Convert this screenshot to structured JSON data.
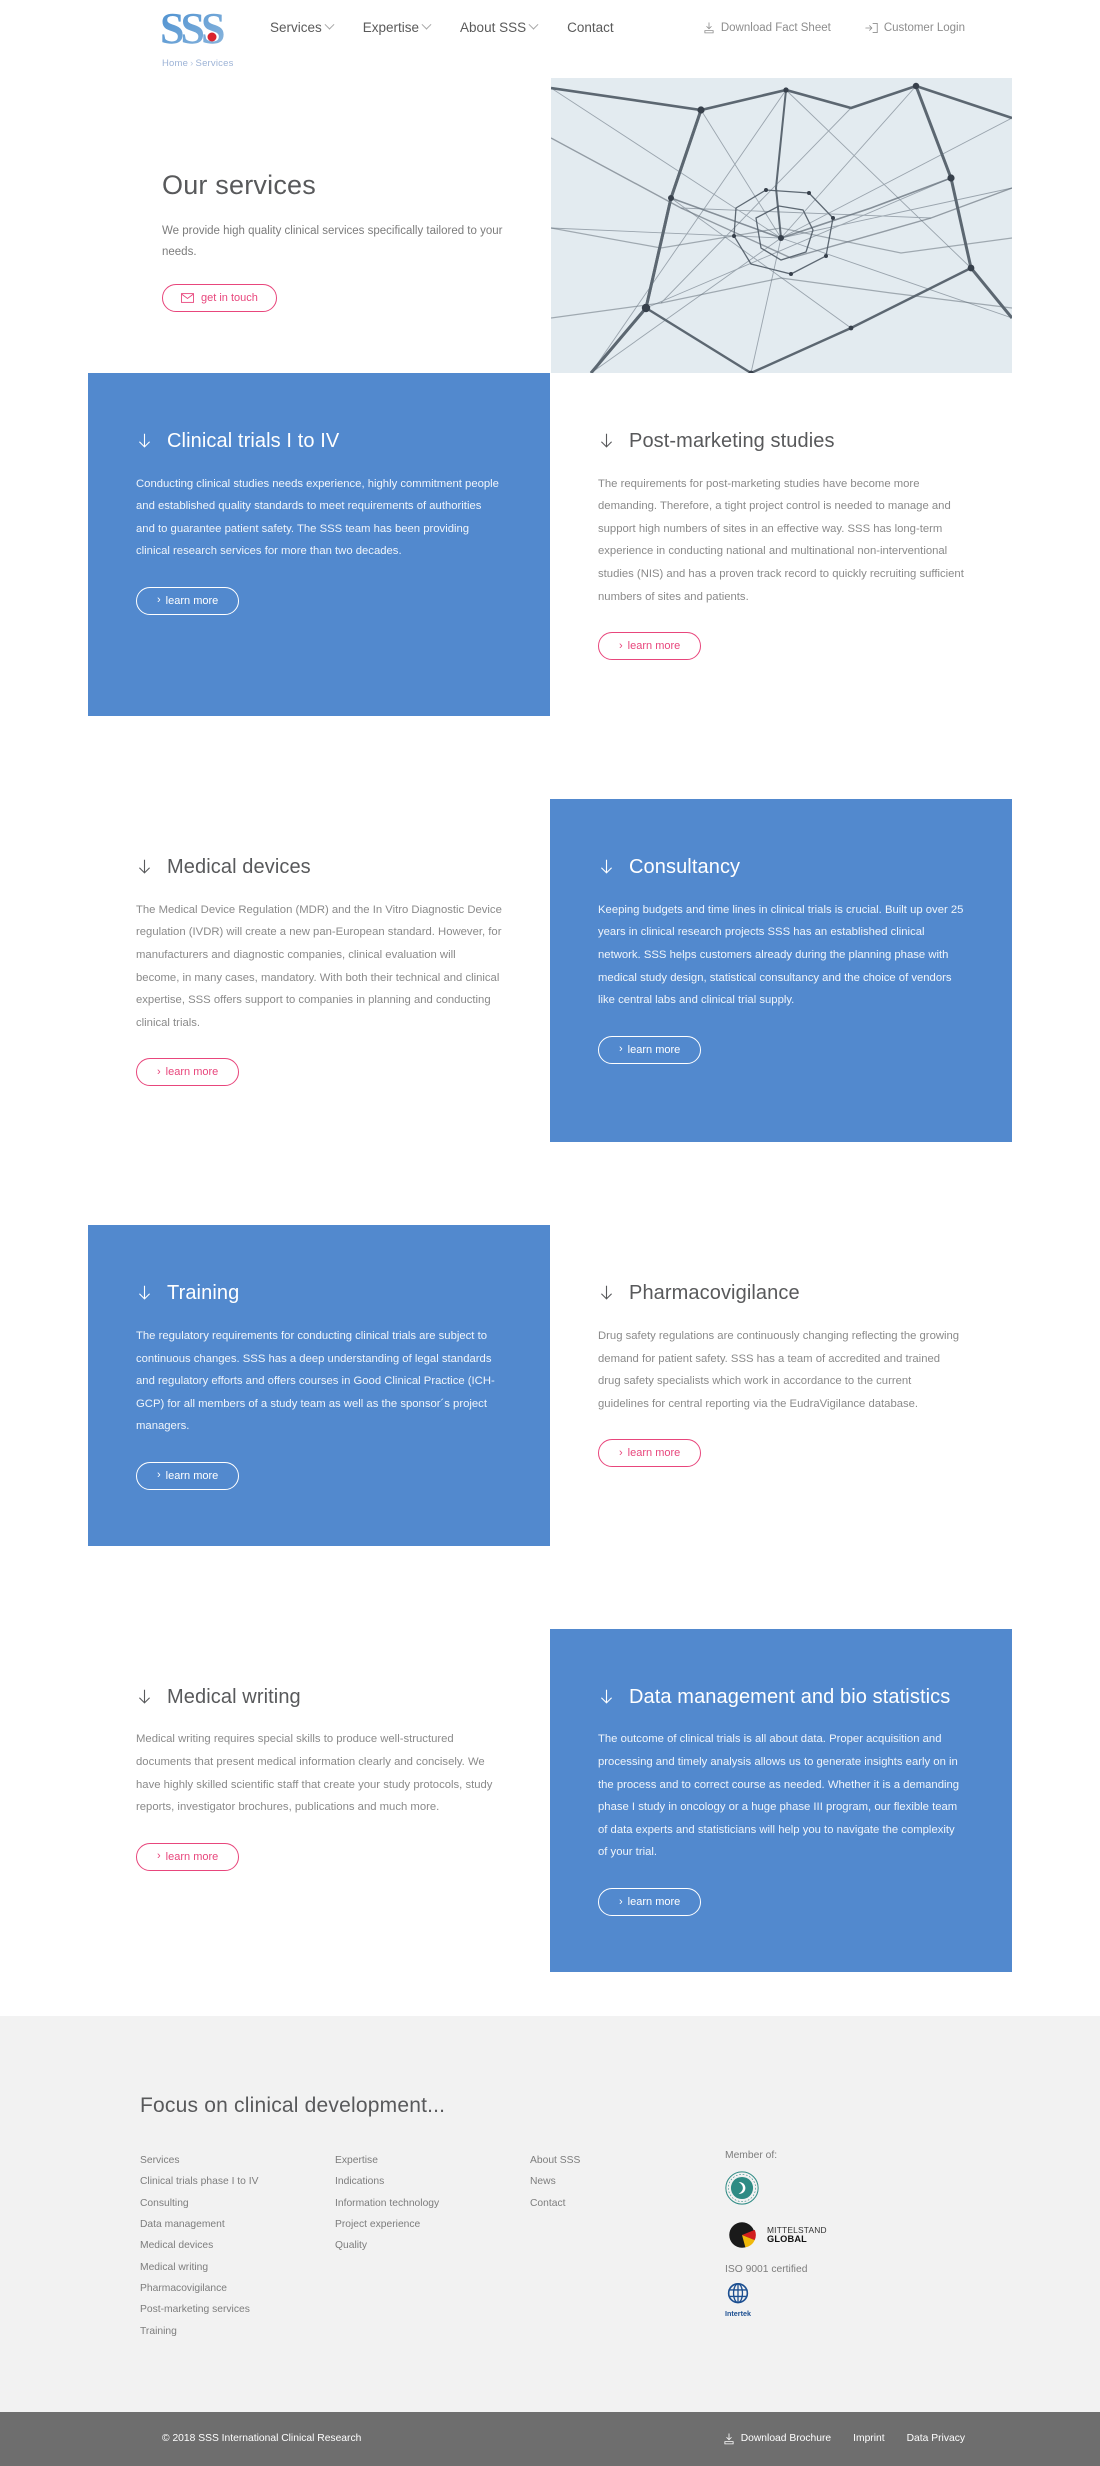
{
  "header": {
    "logo_alt": "SSS",
    "breadcrumb": {
      "home": "Home",
      "separator": "›",
      "current": "Services"
    },
    "nav": [
      {
        "label": "Services",
        "has_caret": true
      },
      {
        "label": "Expertise",
        "has_caret": true
      },
      {
        "label": "About SSS",
        "has_caret": true
      },
      {
        "label": "Contact",
        "has_caret": false
      }
    ],
    "util": [
      {
        "label": "Download Fact Sheet",
        "icon": "download-icon"
      },
      {
        "label": "Customer Login",
        "icon": "login-icon"
      }
    ]
  },
  "hero": {
    "title": "Our services",
    "subtitle": "We provide high quality clinical services specifically tailored to your needs.",
    "cta_label": "get in touch",
    "cta_icon": "envelope-icon"
  },
  "cards": [
    {
      "title": "Clinical trials I to IV",
      "body": "Conducting clinical studies needs experience, highly commitment people and established quality standards to meet requirements of authorities and to guarantee patient safety. The SSS team has been providing clinical research services for more than two decades.",
      "cta": "learn more",
      "theme": "blue"
    },
    {
      "title": "Post-marketing studies",
      "body": "The requirements for post-marketing studies have become more demanding. Therefore, a tight project control is needed to manage and support high numbers of sites in an effective way. SSS has long-term experience in conducting national and multinational non-interventional studies (NIS) and has a proven track record to quickly recruiting sufficient numbers of sites and patients.",
      "cta": "learn more",
      "theme": "white"
    },
    {
      "title": "Medical devices",
      "body": "The Medical Device Regulation (MDR) and the In Vitro Diagnostic Device regulation (IVDR) will create a new pan-European standard. However, for manufacturers and diagnostic companies, clinical evaluation will become, in many cases, mandatory. With both their technical and clinical expertise, SSS offers support to companies in planning and conducting clinical trials.",
      "cta": "learn more",
      "theme": "white"
    },
    {
      "title": "Consultancy",
      "body": "Keeping budgets and time lines in clinical trials is crucial. Built up over 25 years in clinical research projects SSS has an established clinical network. SSS helps customers already during the planning phase with medical study design, statistical consultancy and the choice of vendors like central labs and clinical trial supply.",
      "cta": "learn more",
      "theme": "blue"
    },
    {
      "title": "Training",
      "body": "The regulatory requirements for conducting clinical trials are subject to continuous changes. SSS has a deep understanding of legal standards and regulatory efforts and offers courses in Good Clinical Practice (ICH-GCP) for all members of a study team as well as the sponsor´s project managers.",
      "cta": "learn more",
      "theme": "blue"
    },
    {
      "title": "Pharmacovigilance",
      "body": "Drug safety regulations are continuously changing reflecting the growing demand for patient safety. SSS has a team of accredited and trained drug safety specialists which work in accordance to the current guidelines for central reporting via the EudraVigilance database.",
      "cta": "learn more",
      "theme": "white"
    },
    {
      "title": "Medical writing",
      "body": "Medical writing requires special skills to produce well-structured documents that present medical information clearly and concisely. We have highly skilled scientific staff that create your study protocols, study reports, investigator brochures, publications and much more.",
      "cta": "learn more",
      "theme": "white"
    },
    {
      "title": "Data management and bio statistics",
      "body": "The outcome of clinical trials is all about data. Proper acquisition and processing and timely analysis allows us to generate insights early on in the process and to correct course as needed. Whether it is a demanding phase I study in oncology or a huge phase III program, our flexible team of data experts and statisticians will help you to navigate the complexity of your trial.",
      "cta": "learn more",
      "theme": "blue"
    }
  ],
  "footer": {
    "title": "Focus on clinical development...",
    "columns": [
      [
        "Services",
        "Clinical trials phase I to IV",
        "Consulting",
        "Data management",
        "Medical devices",
        "Medical writing",
        "Pharmacovigilance",
        "Post-marketing services",
        "Training"
      ],
      [
        "Expertise",
        "Indications",
        "Information technology",
        "Project experience",
        "Quality"
      ],
      [
        "About SSS",
        "News",
        "Contact"
      ]
    ],
    "member_label": "Member of:",
    "iso_text": "ISO 9001 certified",
    "mittelstand_line1": "MITTELSTAND",
    "mittelstand_line2": "GLOBAL",
    "intertek_label": "Intertek"
  },
  "bottombar": {
    "copyright": "© 2018 SSS International Clinical Research",
    "links": [
      {
        "label": "Download Brochure",
        "icon": "download-icon"
      },
      {
        "label": "Imprint",
        "icon": null
      },
      {
        "label": "Data Privacy",
        "icon": null
      }
    ]
  },
  "colors": {
    "brand_blue": "#5289ce",
    "accent_pink": "#e8467c",
    "text_gray": "#58595b",
    "footer_bg": "#f2f2f2",
    "bottombar_bg": "#6e6e6e"
  }
}
